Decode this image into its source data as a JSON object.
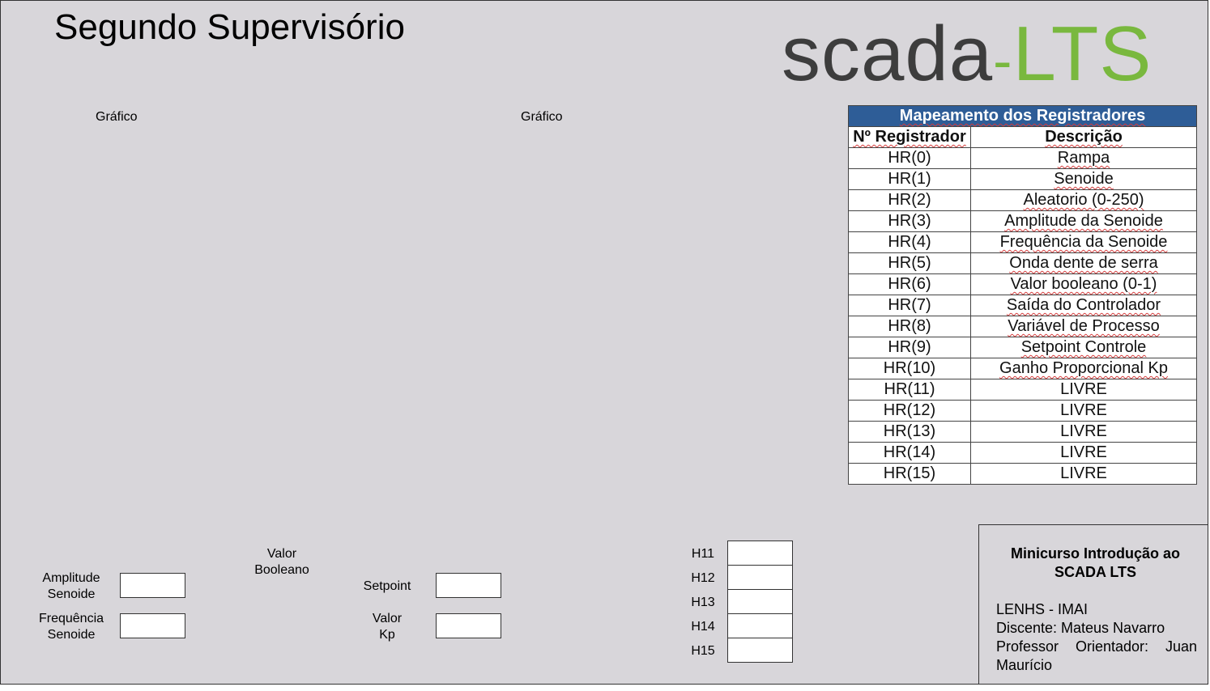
{
  "title": "Segundo Supervisório",
  "logo": {
    "part1": "scada",
    "part2": "-",
    "part3": "LTS"
  },
  "charts": [
    {
      "label": "Gráfico"
    },
    {
      "label": "Gráfico"
    }
  ],
  "register_table": {
    "header": "Mapeamento dos Registradores",
    "columns": [
      "Nº Registrador",
      "Descrição"
    ],
    "rows": [
      [
        "HR(0)",
        "Rampa"
      ],
      [
        "HR(1)",
        "Senoide"
      ],
      [
        "HR(2)",
        "Aleatorio (0-250)"
      ],
      [
        "HR(3)",
        "Amplitude da Senoide"
      ],
      [
        "HR(4)",
        "Frequência da Senoide"
      ],
      [
        "HR(5)",
        "Onda dente de serra"
      ],
      [
        "HR(6)",
        "Valor booleano (0-1)"
      ],
      [
        "HR(7)",
        "Saída do Controlador"
      ],
      [
        "HR(8)",
        "Variável de Processo"
      ],
      [
        "HR(9)",
        "Setpoint Controle"
      ],
      [
        "HR(10)",
        "Ganho Proporcional Kp"
      ],
      [
        "HR(11)",
        "LIVRE"
      ],
      [
        "HR(12)",
        "LIVRE"
      ],
      [
        "HR(13)",
        "LIVRE"
      ],
      [
        "HR(14)",
        "LIVRE"
      ],
      [
        "HR(15)",
        "LIVRE"
      ]
    ]
  },
  "controls": {
    "amplitude": {
      "line1": "Amplitude",
      "line2": "Senoide",
      "value": ""
    },
    "frequencia": {
      "line1": "Frequência",
      "line2": "Senoide",
      "value": ""
    },
    "valor_booleano": {
      "line1": "Valor",
      "line2": "Booleano"
    },
    "setpoint": {
      "label": "Setpoint",
      "value": ""
    },
    "valor_kp": {
      "line1": "Valor",
      "line2": "Kp",
      "value": ""
    },
    "h_fields": [
      {
        "label": "H11",
        "value": ""
      },
      {
        "label": "H12",
        "value": ""
      },
      {
        "label": "H13",
        "value": ""
      },
      {
        "label": "H14",
        "value": ""
      },
      {
        "label": "H15",
        "value": ""
      }
    ]
  },
  "info": {
    "heading_line1": "Minicurso Introdução ao",
    "heading_line2": "SCADA LTS",
    "lines": [
      "LENHS - IMAI",
      "Discente: Mateus Navarro",
      "Professor Orientador: Juan Maurício"
    ]
  }
}
